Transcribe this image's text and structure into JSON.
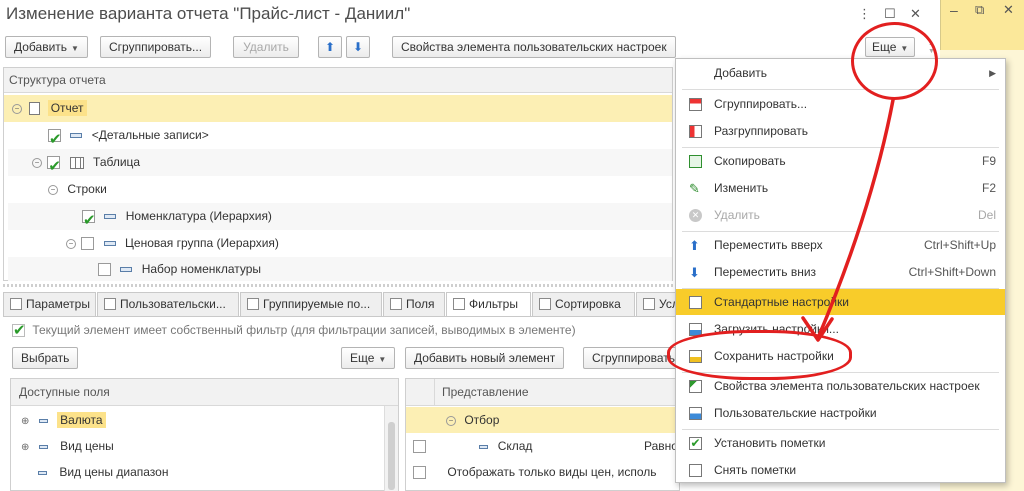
{
  "window": {
    "title": "Изменение варианта отчета \"Прайс-лист - Даниил\"",
    "more_menu_glyph": "⋮",
    "maximize_glyph": "☐",
    "restore_glyph": "⧉",
    "close_glyph": "✕"
  },
  "toolbar": {
    "add_label": "Добавить",
    "group_label": "Сгруппировать...",
    "delete_label": "Удалить",
    "up_glyph": "⬆",
    "down_glyph": "⬇",
    "props_label": "Свойства элемента пользовательских настроек",
    "more_label": "Еще"
  },
  "structure": {
    "header": "Структура отчета",
    "nodes": [
      {
        "label": "Отчет"
      },
      {
        "label": "<Детальные записи>"
      },
      {
        "label": "Таблица"
      },
      {
        "label": "Строки"
      },
      {
        "label": "Номенклатура (Иерархия)"
      },
      {
        "label": "Ценовая группа (Иерархия)"
      },
      {
        "label": "Набор номенклатуры"
      }
    ]
  },
  "tabs": [
    {
      "label": "Параметры"
    },
    {
      "label": "Пользовательски..."
    },
    {
      "label": "Группируемые по..."
    },
    {
      "label": "Поля"
    },
    {
      "label": "Фильтры"
    },
    {
      "label": "Сортировка"
    },
    {
      "label": "Усл"
    }
  ],
  "filters": {
    "own_filter_label": "Текущий элемент имеет собственный фильтр (для фильтрации записей, выводимых в элементе)",
    "select_label": "Выбрать",
    "more_label": "Еще",
    "add_new_label": "Добавить новый элемент",
    "group_label": "Сгруппировать",
    "available_header": "Доступные поля",
    "available_fields": [
      {
        "label": "Валюта"
      },
      {
        "label": "Вид цены"
      },
      {
        "label": "Вид цены диапазон"
      }
    ],
    "repr_header": "Представление",
    "rows": [
      {
        "label": "Отбор"
      },
      {
        "label": "Склад",
        "condition": "Равно"
      },
      {
        "label": "Отображать только виды цен, исполь"
      }
    ]
  },
  "menu": {
    "items": [
      {
        "label": "Добавить",
        "shortcut": "",
        "arrow": "▶"
      },
      {
        "label": "Сгруппировать...",
        "shortcut": ""
      },
      {
        "label": "Разгруппировать",
        "shortcut": ""
      },
      {
        "label": "Скопировать",
        "shortcut": "F9"
      },
      {
        "label": "Изменить",
        "shortcut": "F2"
      },
      {
        "label": "Удалить",
        "shortcut": "Del"
      },
      {
        "label": "Переместить вверх",
        "shortcut": "Ctrl+Shift+Up"
      },
      {
        "label": "Переместить вниз",
        "shortcut": "Ctrl+Shift+Down"
      },
      {
        "label": "Стандартные настройки",
        "shortcut": ""
      },
      {
        "label": "Загрузить настройки...",
        "shortcut": ""
      },
      {
        "label": "Сохранить настройки",
        "shortcut": ""
      },
      {
        "label": "Свойства элемента пользовательских настроек",
        "shortcut": ""
      },
      {
        "label": "Пользовательские настройки",
        "shortcut": ""
      },
      {
        "label": "Установить пометки",
        "shortcut": ""
      },
      {
        "label": "Снять пометки",
        "shortcut": ""
      }
    ]
  },
  "colors": {
    "selection": "#fcefb4",
    "menu_hover": "#f8cc2a",
    "annotation": "#e21f1f",
    "background_window": "#fbe89a"
  }
}
